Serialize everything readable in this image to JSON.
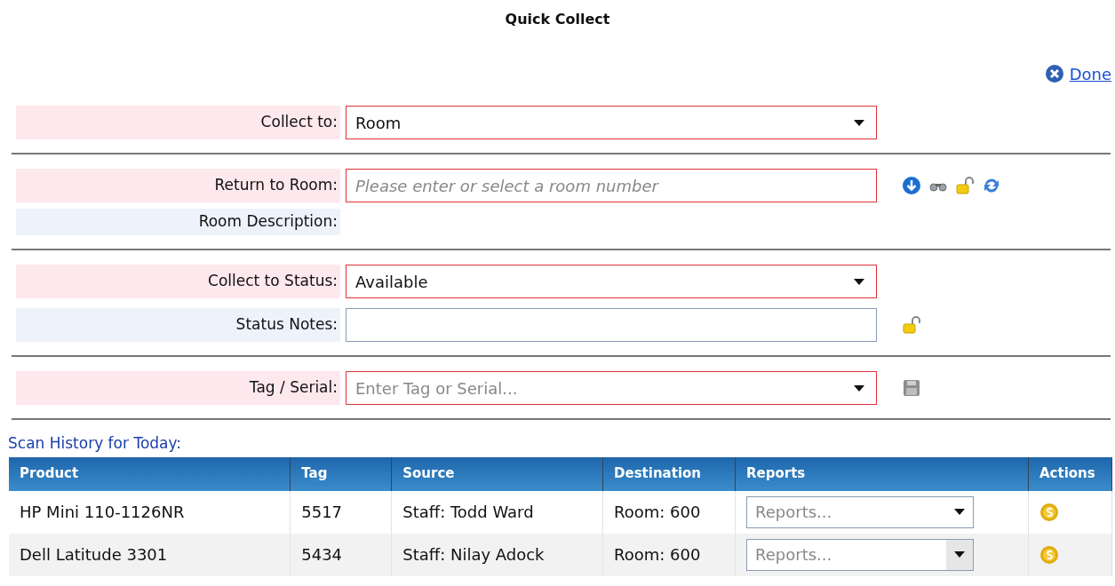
{
  "title": "Quick Collect",
  "done_link": "Done",
  "sections": [
    {
      "rows": [
        {
          "label": "Collect to:",
          "kind": "select",
          "required": true,
          "value": "Room"
        }
      ]
    },
    {
      "rows": [
        {
          "label": "Return to Room:",
          "kind": "text",
          "required": true,
          "placeholder": "Please enter or select a room number"
        },
        {
          "label": "Room Description:",
          "kind": "display",
          "required": false
        }
      ]
    },
    {
      "rows": [
        {
          "label": "Collect to Status:",
          "kind": "select",
          "required": true,
          "value": "Available"
        },
        {
          "label": "Status Notes:",
          "kind": "text",
          "required": false
        }
      ]
    },
    {
      "rows": [
        {
          "label": "Tag / Serial:",
          "kind": "select",
          "required": true,
          "placeholder": "Enter Tag or Serial..."
        }
      ]
    }
  ],
  "scan_history": {
    "heading": "Scan History for Today:",
    "columns": [
      "Product",
      "Tag",
      "Source",
      "Destination",
      "Reports",
      "Actions"
    ],
    "rows": [
      {
        "product": "HP Mini 110-1126NR",
        "tag": "5517",
        "source": "Staff: Todd Ward",
        "destination": "Room: 600",
        "reports_placeholder": "Reports...",
        "reports_hovered": false
      },
      {
        "product": "Dell Latitude 3301",
        "tag": "5434",
        "source": "Staff: Nilay Adock",
        "destination": "Room: 600",
        "reports_placeholder": "Reports...",
        "reports_hovered": true
      }
    ]
  }
}
